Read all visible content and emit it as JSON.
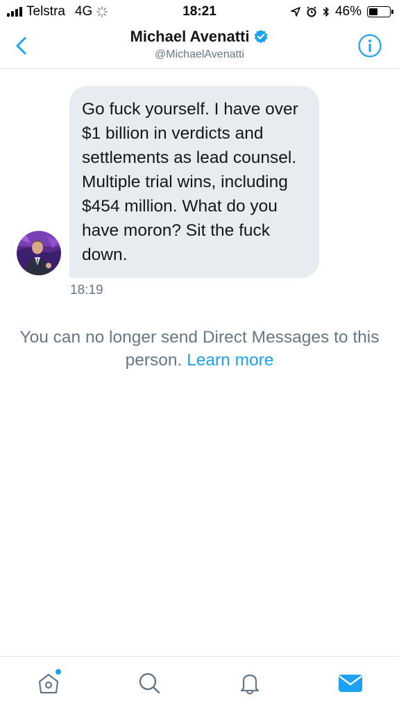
{
  "status_bar": {
    "carrier": "Telstra",
    "network": "4G",
    "time": "18:21",
    "battery_percent": "46%",
    "battery_level": 0.46,
    "icons": [
      "signal-icon",
      "loading-icon",
      "location-icon",
      "alarm-icon",
      "bluetooth-icon",
      "battery-icon"
    ]
  },
  "header": {
    "name": "Michael Avenatti",
    "handle": "@MichaelAvenatti",
    "verified": true,
    "icons": [
      "back-chevron-icon",
      "verified-badge-icon",
      "info-icon"
    ]
  },
  "conversation": {
    "messages": [
      {
        "text": "Go fuck yourself. I have over $1 billion in verdicts and settlements as lead counsel. Multiple trial wins, including $454 million. What do you have moron? Sit the fuck down.",
        "time": "18:19"
      }
    ],
    "notice": {
      "text": "You can no longer send Direct Messages to this person.",
      "link": "Learn more"
    }
  },
  "tab_bar": {
    "tabs": [
      "home-icon",
      "search-icon",
      "notifications-icon",
      "messages-icon"
    ],
    "active": "messages-icon"
  },
  "colors": {
    "accent": "#1da1f2",
    "bubble": "#e6ecf0",
    "secondary_text": "#657786",
    "primary_text": "#14171a"
  }
}
